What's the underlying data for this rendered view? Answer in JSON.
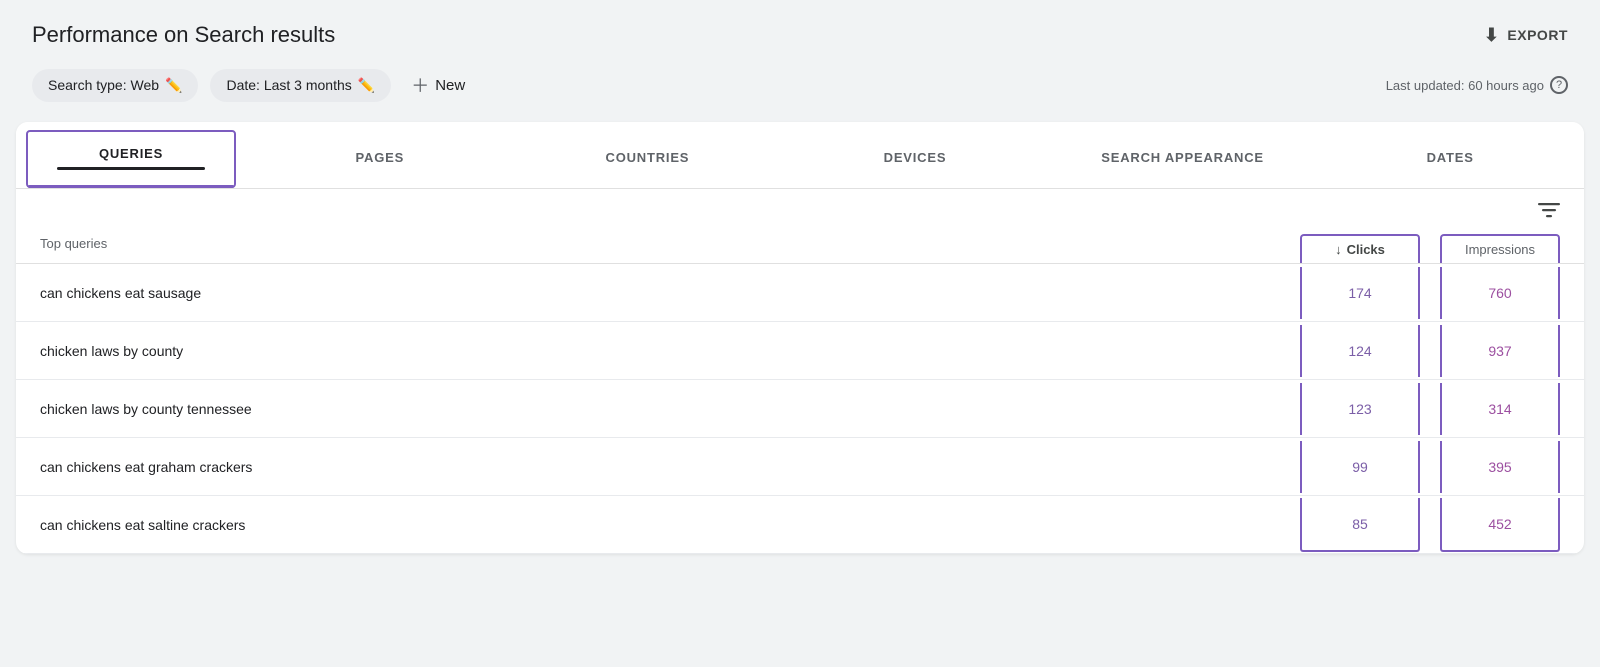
{
  "header": {
    "title": "Performance on Search results",
    "export_label": "EXPORT"
  },
  "filters": {
    "search_type": "Search type: Web",
    "date": "Date: Last 3 months",
    "new_label": "New",
    "last_updated": "Last updated: 60 hours ago"
  },
  "tabs": [
    {
      "id": "queries",
      "label": "QUERIES",
      "active": true
    },
    {
      "id": "pages",
      "label": "PAGES",
      "active": false
    },
    {
      "id": "countries",
      "label": "COUNTRIES",
      "active": false
    },
    {
      "id": "devices",
      "label": "DEVICES",
      "active": false
    },
    {
      "id": "search-appearance",
      "label": "SEARCH APPEARANCE",
      "active": false
    },
    {
      "id": "dates",
      "label": "DATES",
      "active": false
    }
  ],
  "table": {
    "top_queries_label": "Top queries",
    "col_clicks": "Clicks",
    "col_impressions": "Impressions",
    "rows": [
      {
        "query": "can chickens eat sausage",
        "clicks": "174",
        "impressions": "760"
      },
      {
        "query": "chicken laws by county",
        "clicks": "124",
        "impressions": "937"
      },
      {
        "query": "chicken laws by county tennessee",
        "clicks": "123",
        "impressions": "314"
      },
      {
        "query": "can chickens eat graham crackers",
        "clicks": "99",
        "impressions": "395"
      },
      {
        "query": "can chickens eat saltine crackers",
        "clicks": "85",
        "impressions": "452"
      }
    ]
  }
}
